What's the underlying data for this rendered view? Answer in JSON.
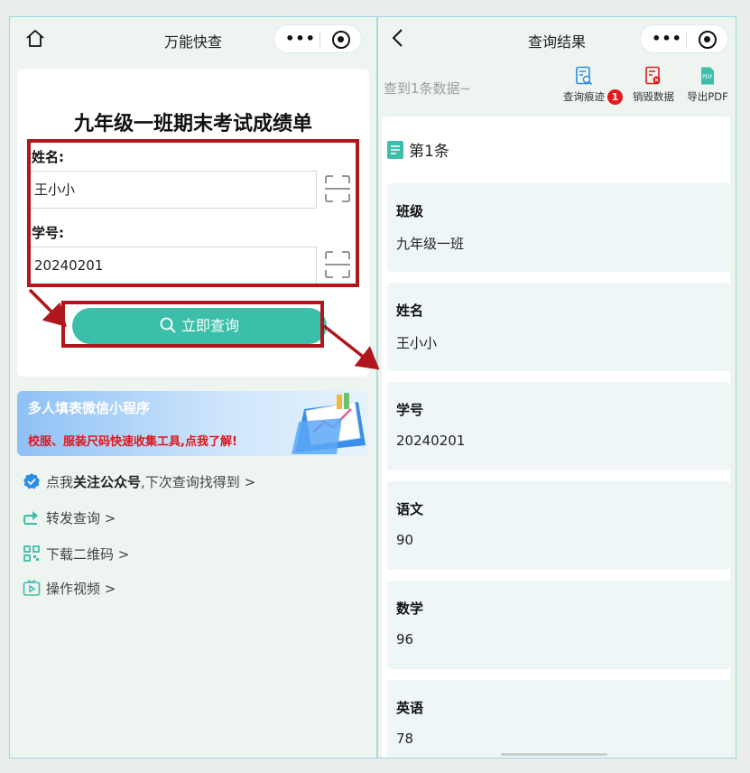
{
  "left": {
    "nav": {
      "title": "万能快查",
      "more": "•••"
    },
    "form": {
      "title": "九年级一班期末考试成绩单",
      "name_label": "姓名:",
      "name_value": "王小小",
      "id_label": "学号:",
      "id_value": "20240201",
      "submit_label": "立即查询"
    },
    "banner": {
      "title": "多人填表微信小程序",
      "subtitle": "校服、服装尺码快速收集工具,点我了解!"
    },
    "links": {
      "follow_prefix": "点我",
      "follow_bold": "关注公众号",
      "follow_suffix": ",下次查询找得到 >",
      "share": "转发查询 >",
      "qrcode": "下载二维码 >",
      "video": "操作视频 >"
    }
  },
  "right": {
    "nav": {
      "title": "查询结果",
      "more": "•••"
    },
    "toolbar": {
      "count_text": "查到1条数据~",
      "history_label": "查询痕迹",
      "history_badge": "1",
      "destroy_label": "销毁数据",
      "export_label": "导出PDF"
    },
    "entry_title": "第1条",
    "fields": [
      {
        "key": "班级",
        "value": "九年级一班"
      },
      {
        "key": "姓名",
        "value": "王小小"
      },
      {
        "key": "学号",
        "value": "20240201"
      },
      {
        "key": "语文",
        "value": "90"
      },
      {
        "key": "数学",
        "value": "96"
      },
      {
        "key": "英语",
        "value": "78"
      }
    ]
  },
  "colors": {
    "accent": "#3bbfaa",
    "highlight": "#b0161c",
    "badge": "#e5181c",
    "banner_sub": "#e0161a"
  },
  "icons": [
    "home-icon",
    "back-icon",
    "more-icon",
    "target-icon",
    "scan-icon",
    "search-icon",
    "history-icon",
    "delete-data-icon",
    "pdf-icon",
    "list-icon",
    "verified-icon",
    "share-icon",
    "qrcode-icon",
    "video-icon"
  ]
}
